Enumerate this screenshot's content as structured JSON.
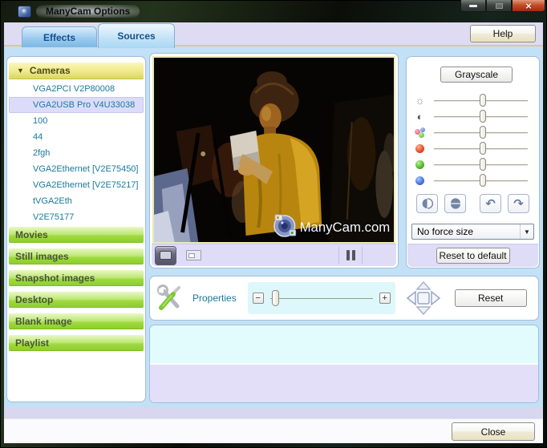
{
  "colors": {
    "dialog_blue": "#c2e0f6",
    "strip_lavender": "#dedcf6",
    "header_yellow": "#dcd75e",
    "category_green": "#a0da3e",
    "camera_text": "#187a9c",
    "selected_row": "#dcdcfa",
    "tab_text": "#15508e",
    "video_border": "#e9e9b4"
  },
  "window": {
    "title": "ManyCam Options"
  },
  "tabs": {
    "effects": "Effects",
    "sources": "Sources"
  },
  "help_button": "Help",
  "sidebar": {
    "cameras_header": "Cameras",
    "cameras": [
      {
        "label": "VGA2PCI V2P80008",
        "selected": false
      },
      {
        "label": "VGA2USB Pro V4U33038",
        "selected": true
      },
      {
        "label": "100",
        "selected": false
      },
      {
        "label": "44",
        "selected": false
      },
      {
        "label": "2fgh",
        "selected": false
      },
      {
        "label": "VGA2Ethernet [V2E75450]",
        "selected": false
      },
      {
        "label": "VGA2Ethernet [V2E75217]",
        "selected": false
      },
      {
        "label": "tVGA2Eth",
        "selected": false
      },
      {
        "label": "V2E75177",
        "selected": false
      }
    ],
    "categories": [
      "Movies",
      "Still images",
      "Snapshot images",
      "Desktop",
      "Blank image",
      "Playlist"
    ]
  },
  "preview": {
    "watermark": "ManyCam.com"
  },
  "adjustments": {
    "grayscale_button": "Grayscale",
    "sliders": [
      {
        "name": "brightness",
        "value": 52
      },
      {
        "name": "contrast",
        "value": 52
      },
      {
        "name": "colors",
        "value": 52
      },
      {
        "name": "red",
        "value": 52
      },
      {
        "name": "green",
        "value": 52
      },
      {
        "name": "blue",
        "value": 52
      }
    ],
    "force_size_selected": "No force size",
    "reset_default_button": "Reset to default"
  },
  "properties": {
    "label": "Properties",
    "zoom_value": 5,
    "reset_button": "Reset"
  },
  "footer": {
    "close_button": "Close"
  }
}
